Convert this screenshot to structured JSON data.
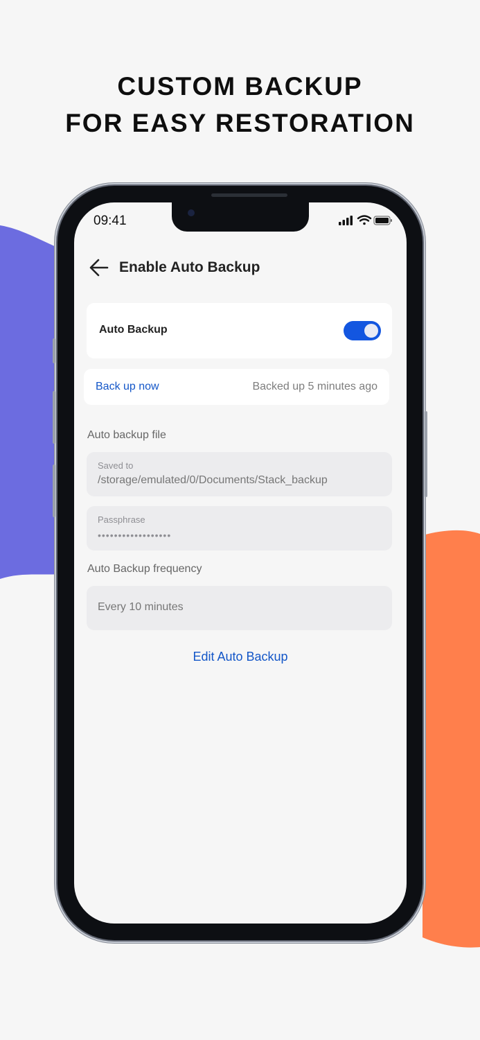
{
  "headline": {
    "line1": "CUSTOM BACKUP",
    "line2": "FOR EASY RESTORATION"
  },
  "colors": {
    "accent": "#1356e0",
    "link": "#1356c8",
    "blob_left": "#6c6ce0",
    "blob_right": "#ff7f4c"
  },
  "status_bar": {
    "time": "09:41",
    "icons": [
      "signal-icon",
      "wifi-icon",
      "battery-icon"
    ]
  },
  "app_bar": {
    "back_icon": "arrow-left-icon",
    "title": "Enable Auto Backup"
  },
  "auto_backup": {
    "label": "Auto Backup",
    "enabled": true
  },
  "backup_now": {
    "action": "Back up now",
    "status": "Backed up 5 minutes ago"
  },
  "backup_file": {
    "section_label": "Auto backup file",
    "saved_to_caption": "Saved to",
    "saved_to_value": "/storage/emulated/0/Documents/Stack_backup",
    "passphrase_caption": "Passphrase",
    "passphrase_value": "••••••••••••••••••"
  },
  "frequency": {
    "section_label": "Auto Backup frequency",
    "value": "Every 10 minutes"
  },
  "edit_action": "Edit Auto Backup"
}
